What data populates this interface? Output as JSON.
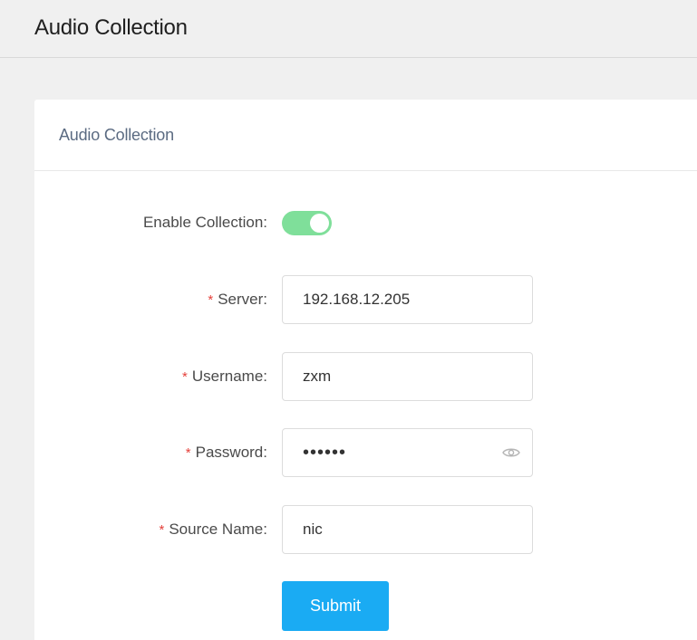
{
  "header": {
    "title": "Audio Collection"
  },
  "card": {
    "title": "Audio Collection"
  },
  "form": {
    "enable": {
      "label": "Enable Collection:",
      "enabled": true
    },
    "server": {
      "required_mark": "*",
      "label": "Server:",
      "value": "192.168.12.205"
    },
    "username": {
      "required_mark": "*",
      "label": "Username:",
      "value": "zxm"
    },
    "password": {
      "required_mark": "*",
      "label": "Password:",
      "value": "••••••"
    },
    "source_name": {
      "required_mark": "*",
      "label": "Source Name:",
      "value": "nic"
    },
    "submit_label": "Submit"
  },
  "colors": {
    "toggle_on": "#7fdf9a",
    "submit": "#1aabf3",
    "required": "#e5413b",
    "card_title": "#5b6b82"
  },
  "icons": {
    "password_reveal": "eye-icon"
  }
}
